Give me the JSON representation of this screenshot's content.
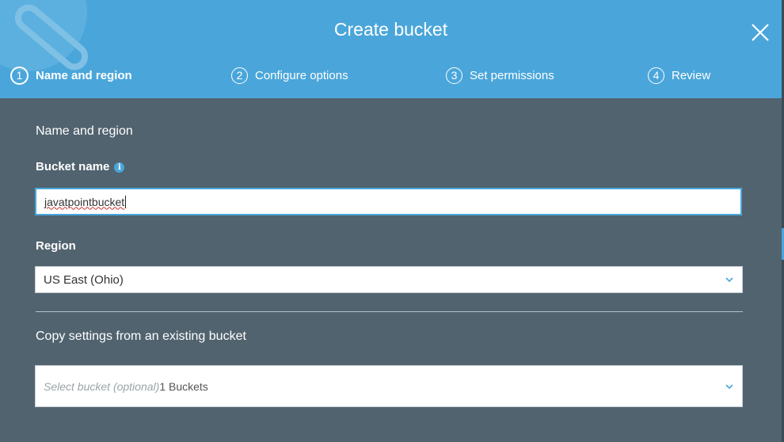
{
  "dialog": {
    "title": "Create bucket"
  },
  "steps": [
    {
      "num": "1",
      "label": "Name and region"
    },
    {
      "num": "2",
      "label": "Configure options"
    },
    {
      "num": "3",
      "label": "Set permissions"
    },
    {
      "num": "4",
      "label": "Review"
    }
  ],
  "active_step": 1,
  "form": {
    "section_title": "Name and region",
    "bucket_name_label": "Bucket name",
    "bucket_name_value": "javatpointbucket",
    "region_label": "Region",
    "region_value": "US East (Ohio)",
    "copy_title": "Copy settings from an existing bucket",
    "copy_placeholder": "Select bucket (optional)",
    "copy_count": "1 Buckets"
  },
  "colors": {
    "header": "#4aa6da",
    "body": "#51636f",
    "accent": "#4aa6da"
  },
  "icons": {
    "close": "close-icon",
    "info": "info-icon",
    "dropdown": "chevron-down-icon"
  }
}
